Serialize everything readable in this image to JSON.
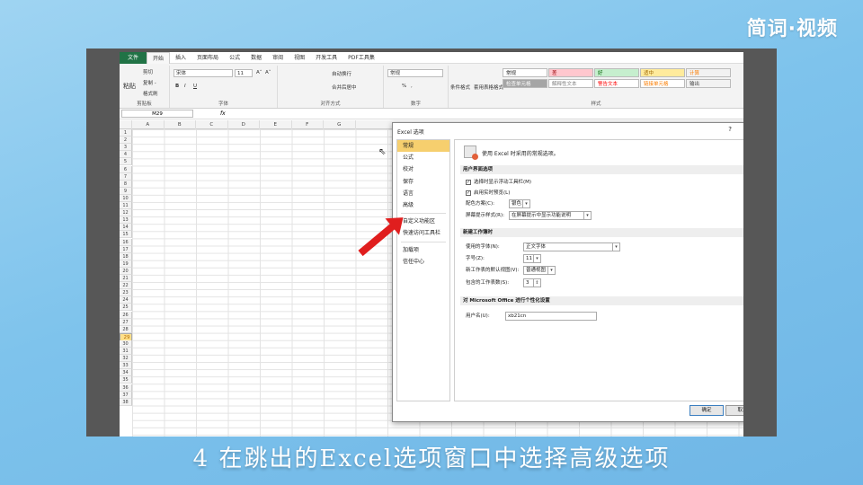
{
  "brand": "简词·视频",
  "caption": "4 在跳出的Excel选项窗口中选择高级选项",
  "accent_green": "#217346",
  "highlight_color": "#f6cf6e",
  "arrow_color": "#e01e1e",
  "excel": {
    "tabs": [
      "文件",
      "开始",
      "插入",
      "页面布局",
      "公式",
      "数据",
      "审阅",
      "视图",
      "开发工具",
      "PDF工具集"
    ],
    "ribbon": {
      "clipboard": {
        "cut": "剪切",
        "copy": "复制 -",
        "paste": "粘贴",
        "format_painter": "格式刷",
        "label": "剪贴板"
      },
      "font": {
        "name": "宋体",
        "size": "11",
        "grow": "A˄",
        "shrink": "A˅",
        "bold": "B",
        "italic": "I",
        "underline": "U",
        "label": "字体"
      },
      "alignment": {
        "wrap": "自动换行",
        "merge": "合并后居中",
        "label": "对齐方式"
      },
      "number": {
        "format": "常规",
        "percent": "%",
        "comma": ",",
        "label": "数字"
      },
      "styles": {
        "cond_format": "条件格式",
        "table_format": "套用表格格式",
        "cells": [
          {
            "text": "常规",
            "bg": "#ffffff",
            "fg": "#222222"
          },
          {
            "text": "差",
            "bg": "#ffc7ce",
            "fg": "#9c0006"
          },
          {
            "text": "好",
            "bg": "#c6efce",
            "fg": "#006100"
          },
          {
            "text": "适中",
            "bg": "#ffeb9c",
            "fg": "#9c6500"
          },
          {
            "text": "计算",
            "bg": "#f2f2f2",
            "fg": "#fa7d00"
          },
          {
            "text": "检查单元格",
            "bg": "#a5a5a5",
            "fg": "#ffffff"
          },
          {
            "text": "解释性文本",
            "bg": "#ffffff",
            "fg": "#7f7f7f"
          },
          {
            "text": "警告文本",
            "bg": "#ffffff",
            "fg": "#ff0000"
          },
          {
            "text": "链接单元格",
            "bg": "#ffffff",
            "fg": "#fa7d00"
          },
          {
            "text": "输出",
            "bg": "#f2f2f2",
            "fg": "#3f3f3f"
          }
        ],
        "label": "样式"
      }
    },
    "name_box": "M29",
    "fx": "fx",
    "columns": [
      "A",
      "B",
      "C",
      "D",
      "E",
      "F",
      "G"
    ],
    "rows": [
      "1",
      "2",
      "3",
      "4",
      "5",
      "6",
      "7",
      "8",
      "9",
      "10",
      "11",
      "12",
      "13",
      "14",
      "15",
      "16",
      "17",
      "18",
      "19",
      "20",
      "21",
      "22",
      "23",
      "24",
      "25",
      "26",
      "27",
      "28",
      "29",
      "30",
      "31",
      "32",
      "33",
      "34",
      "35",
      "36",
      "37",
      "38"
    ],
    "selected_row": "29"
  },
  "dialog": {
    "title": "Excel 选项",
    "help": "?",
    "close": "×",
    "nav": [
      "常规",
      "公式",
      "校对",
      "保存",
      "语言",
      "高级",
      "自定义功能区",
      "快速访问工具栏",
      "加载项",
      "信任中心"
    ],
    "active_nav": 0,
    "intro": "使用 Excel 时采用的常规选项。",
    "section_ui": "用户界面选项",
    "show_mini_toolbar": "选择时显示浮动工具栏(M)",
    "live_preview": "启用实时预览(L)",
    "color_scheme_label": "配色方案(C):",
    "color_scheme_value": "银色",
    "screentip_label": "屏幕提示样式(R):",
    "screentip_value": "在屏幕提示中显示功能说明",
    "section_new": "新建工作簿时",
    "font_label": "使用的字体(N):",
    "font_value": "正文字体",
    "size_label": "字号(Z):",
    "size_value": "11",
    "view_label": "新工作表的默认视图(V):",
    "view_value": "普通视图",
    "sheets_label": "包含的工作表数(S):",
    "sheets_value": "3",
    "section_personal": "对 Microsoft Office 进行个性化设置",
    "username_label": "用户名(U):",
    "username_value": "xb21cn",
    "ok": "确定",
    "cancel": "取消"
  }
}
